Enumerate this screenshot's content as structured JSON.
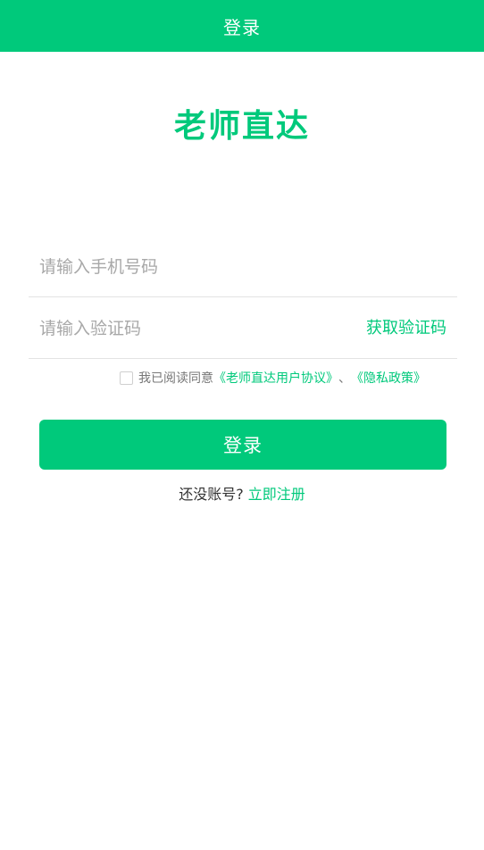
{
  "colors": {
    "primary": "#00c97b",
    "text_dark": "#333333",
    "text_muted": "#777777",
    "placeholder": "#a8a8a8"
  },
  "header": {
    "title": "登录"
  },
  "app": {
    "title": "老师直达"
  },
  "form": {
    "phone_placeholder": "请输入手机号码",
    "phone_value": "",
    "code_placeholder": "请输入验证码",
    "code_value": "",
    "get_code_label": "获取验证码"
  },
  "agreement": {
    "checked": false,
    "prefix": "我已阅读同意",
    "user_agreement": "《老师直达用户协议》",
    "separator": "、",
    "privacy_policy": "《隐私政策》"
  },
  "login_button": {
    "label": "登录"
  },
  "register": {
    "prompt": "还没账号?",
    "link": "立即注册"
  }
}
